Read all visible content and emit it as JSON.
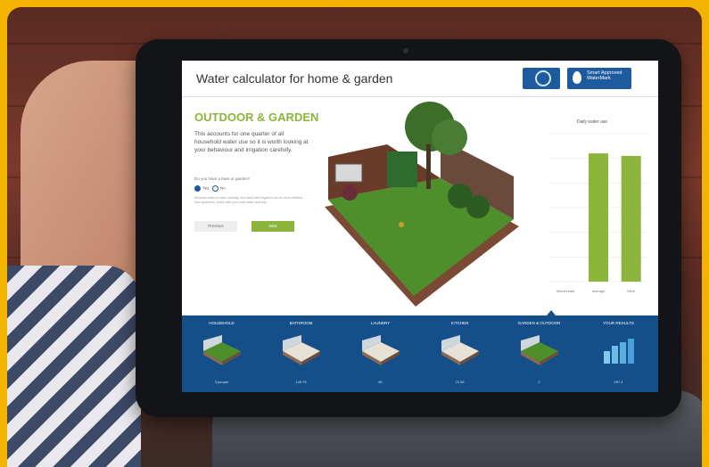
{
  "app": {
    "title": "Water calculator for home & garden",
    "logo_text": "Smart Approved WaterMark"
  },
  "section": {
    "title": "OUTDOOR & GARDEN",
    "description": "This accounts for one quarter of all household water use so it is worth looking at your behaviour and irrigation carefully.",
    "question": "Do you have a lawn or garden?",
    "options": [
      "Yes",
      "No"
    ],
    "hint": "Because water is used carefully, and hand-held irrigation can be more efficient than sprinklers, check with your local water authority.",
    "prev_label": "Previous",
    "next_label": "Next"
  },
  "chart_data": {
    "type": "bar",
    "title": "Daily water use",
    "categories": [
      "Benchmark",
      "Average",
      "Mine"
    ],
    "values": [
      0,
      520,
      510
    ],
    "ylim": [
      0,
      600
    ],
    "ytick_count": 7,
    "colors": [
      "#8bb63b"
    ]
  },
  "nav": {
    "items": [
      {
        "label": "HOUSEHOLD",
        "value": "3 people"
      },
      {
        "label": "BATHROOM",
        "value": "145.75"
      },
      {
        "label": "LAUNDRY",
        "value": "80"
      },
      {
        "label": "KITCHEN",
        "value": "72.35"
      },
      {
        "label": "GARDEN & OUTDOOR",
        "value": "0"
      },
      {
        "label": "YOUR RESULTS",
        "value": "297.4"
      }
    ],
    "active_index": 4
  },
  "colors": {
    "accent": "#8bb63b",
    "nav_bg": "#154f8a",
    "frame": "#f2b400"
  }
}
